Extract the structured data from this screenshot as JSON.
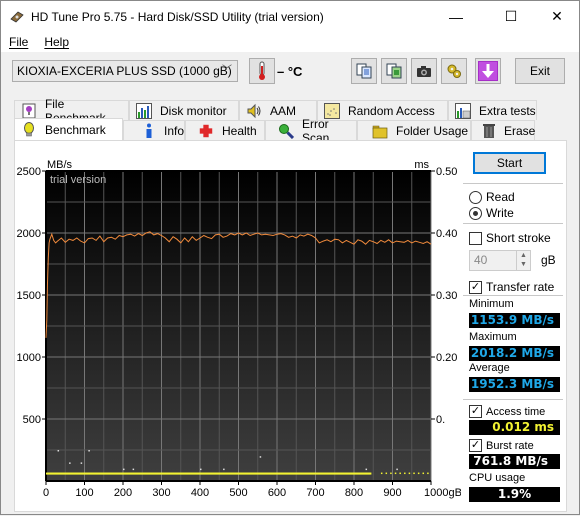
{
  "window": {
    "title": "HD Tune Pro 5.75 - Hard Disk/SSD Utility (trial version)",
    "controls": {
      "minimize": "—",
      "maximize": "☐",
      "close": "✕"
    }
  },
  "menu": {
    "items": [
      {
        "label": "File",
        "accel": "F"
      },
      {
        "label": "Help",
        "accel": "H"
      }
    ]
  },
  "toolbar": {
    "drive": "KIOXIA-EXCERIA PLUS SSD (1000 gB)",
    "temperature": "– °C",
    "buttons": [
      "copy-info-icon",
      "copy-screenshot-icon",
      "camera-icon",
      "options-icon",
      "save-download-icon"
    ],
    "exit_label": "Exit"
  },
  "tabs": {
    "top_row": [
      {
        "label": "File Benchmark",
        "icon": "file-benchmark-icon"
      },
      {
        "label": "Disk monitor",
        "icon": "disk-monitor-icon"
      },
      {
        "label": "AAM",
        "icon": "speaker-icon"
      },
      {
        "label": "Random Access",
        "icon": "random-access-icon"
      },
      {
        "label": "Extra tests",
        "icon": "extra-tests-icon"
      }
    ],
    "bottom_row": [
      {
        "label": "Benchmark",
        "icon": "lightbulb-icon",
        "active": true
      },
      {
        "label": "Info",
        "icon": "info-icon"
      },
      {
        "label": "Health",
        "icon": "health-cross-icon"
      },
      {
        "label": "Error Scan",
        "icon": "magnifier-icon"
      },
      {
        "label": "Folder Usage",
        "icon": "folder-icon"
      },
      {
        "label": "Erase",
        "icon": "trash-icon"
      }
    ]
  },
  "controls": {
    "start_label": "Start",
    "read_label": "Read",
    "write_label": "Write",
    "mode": "Write",
    "short_stroke_label": "Short stroke",
    "short_stroke_checked": false,
    "short_stroke_value": "40",
    "short_stroke_unit": "gB",
    "transfer_rate_label": "Transfer rate",
    "transfer_rate_checked": true
  },
  "stats": {
    "minimum_label": "Minimum",
    "minimum": "1153.9 MB/s",
    "maximum_label": "Maximum",
    "maximum": "2018.2 MB/s",
    "average_label": "Average",
    "average": "1952.3 MB/s",
    "access_time_label": "Access time",
    "access_time_checked": true,
    "access_time": "0.012 ms",
    "burst_rate_label": "Burst rate",
    "burst_rate_checked": true,
    "burst_rate": "761.8 MB/s",
    "cpu_label": "CPU usage",
    "cpu": "1.9%"
  },
  "chart_data": {
    "type": "line",
    "watermark": "trial version",
    "ylabel_left": "MB/s",
    "ylabel_right": "ms",
    "xlabel": "gB",
    "x_ticks": [
      "0",
      "100",
      "200",
      "300",
      "400",
      "500",
      "600",
      "700",
      "800",
      "900",
      "1000gB"
    ],
    "y_left_ticks": [
      "2500",
      "2000",
      "1500",
      "1000",
      "500"
    ],
    "y_right_ticks": [
      "0.50",
      "0.40",
      "0.30",
      "0.20",
      "0."
    ],
    "xlim": [
      0,
      1000
    ],
    "ylim_left": [
      0,
      2500
    ],
    "ylim_right": [
      0,
      0.5
    ],
    "grid": true,
    "series": [
      {
        "name": "Transfer rate (MB/s)",
        "color": "#f08a3c",
        "x": [
          0,
          2,
          4,
          6,
          8,
          10,
          15,
          20,
          25,
          30,
          40,
          50,
          60,
          70,
          80,
          90,
          100,
          110,
          120,
          130,
          140,
          150,
          160,
          170,
          180,
          190,
          200,
          210,
          220,
          230,
          240,
          250,
          260,
          270,
          280,
          290,
          300,
          310,
          320,
          330,
          340,
          350,
          360,
          370,
          380,
          390,
          400,
          410,
          420,
          430,
          440,
          450,
          460,
          470,
          480,
          490,
          500,
          510,
          520,
          530,
          540,
          550,
          560,
          570,
          580,
          590,
          600,
          610,
          620,
          630,
          640,
          650,
          660,
          670,
          680,
          690,
          700,
          710,
          720,
          730,
          740,
          750,
          760,
          770,
          780,
          790,
          800,
          810,
          820,
          830,
          840,
          850,
          860,
          870,
          880,
          890,
          900,
          910,
          920,
          930,
          940,
          950,
          960,
          970,
          980,
          990,
          1000
        ],
        "values": [
          1154,
          1300,
          1600,
          1800,
          1920,
          1950,
          1990,
          1940,
          1920,
          1935,
          1960,
          1925,
          1950,
          1940,
          1960,
          1935,
          1920,
          1955,
          1960,
          1940,
          1975,
          1930,
          1960,
          1965,
          1950,
          1980,
          1970,
          1985,
          1990,
          1975,
          1995,
          1980,
          2000,
          2010,
          1985,
          1995,
          1980,
          1960,
          1930,
          1970,
          1950,
          1920,
          1960,
          1930,
          1970,
          1940,
          1960,
          1980,
          1965,
          1955,
          1985,
          1990,
          1965,
          1975,
          1995,
          1985,
          2000,
          1985,
          2000,
          1980,
          1990,
          2000,
          1985,
          1990,
          1985,
          1980,
          1990,
          1995,
          1985,
          1965,
          1975,
          1960,
          1985,
          1975,
          1990,
          1980,
          1960,
          1920,
          1935,
          1945,
          1930,
          1950,
          1945,
          1920,
          1940,
          1925,
          1910,
          1945,
          1935,
          1910,
          1940,
          1930,
          1915,
          1940,
          1925,
          1945,
          1920,
          1935,
          1930,
          1925,
          1940,
          1920,
          1935,
          1925,
          1915,
          1930,
          1910
        ]
      },
      {
        "name": "Access time (ms)",
        "color": "#f2f232",
        "axis": "right",
        "x": [
          0,
          100,
          200,
          300,
          400,
          500,
          600,
          700,
          800,
          840
        ],
        "values": [
          0.012,
          0.012,
          0.012,
          0.012,
          0.012,
          0.012,
          0.012,
          0.012,
          0.012,
          0.012
        ]
      }
    ]
  }
}
